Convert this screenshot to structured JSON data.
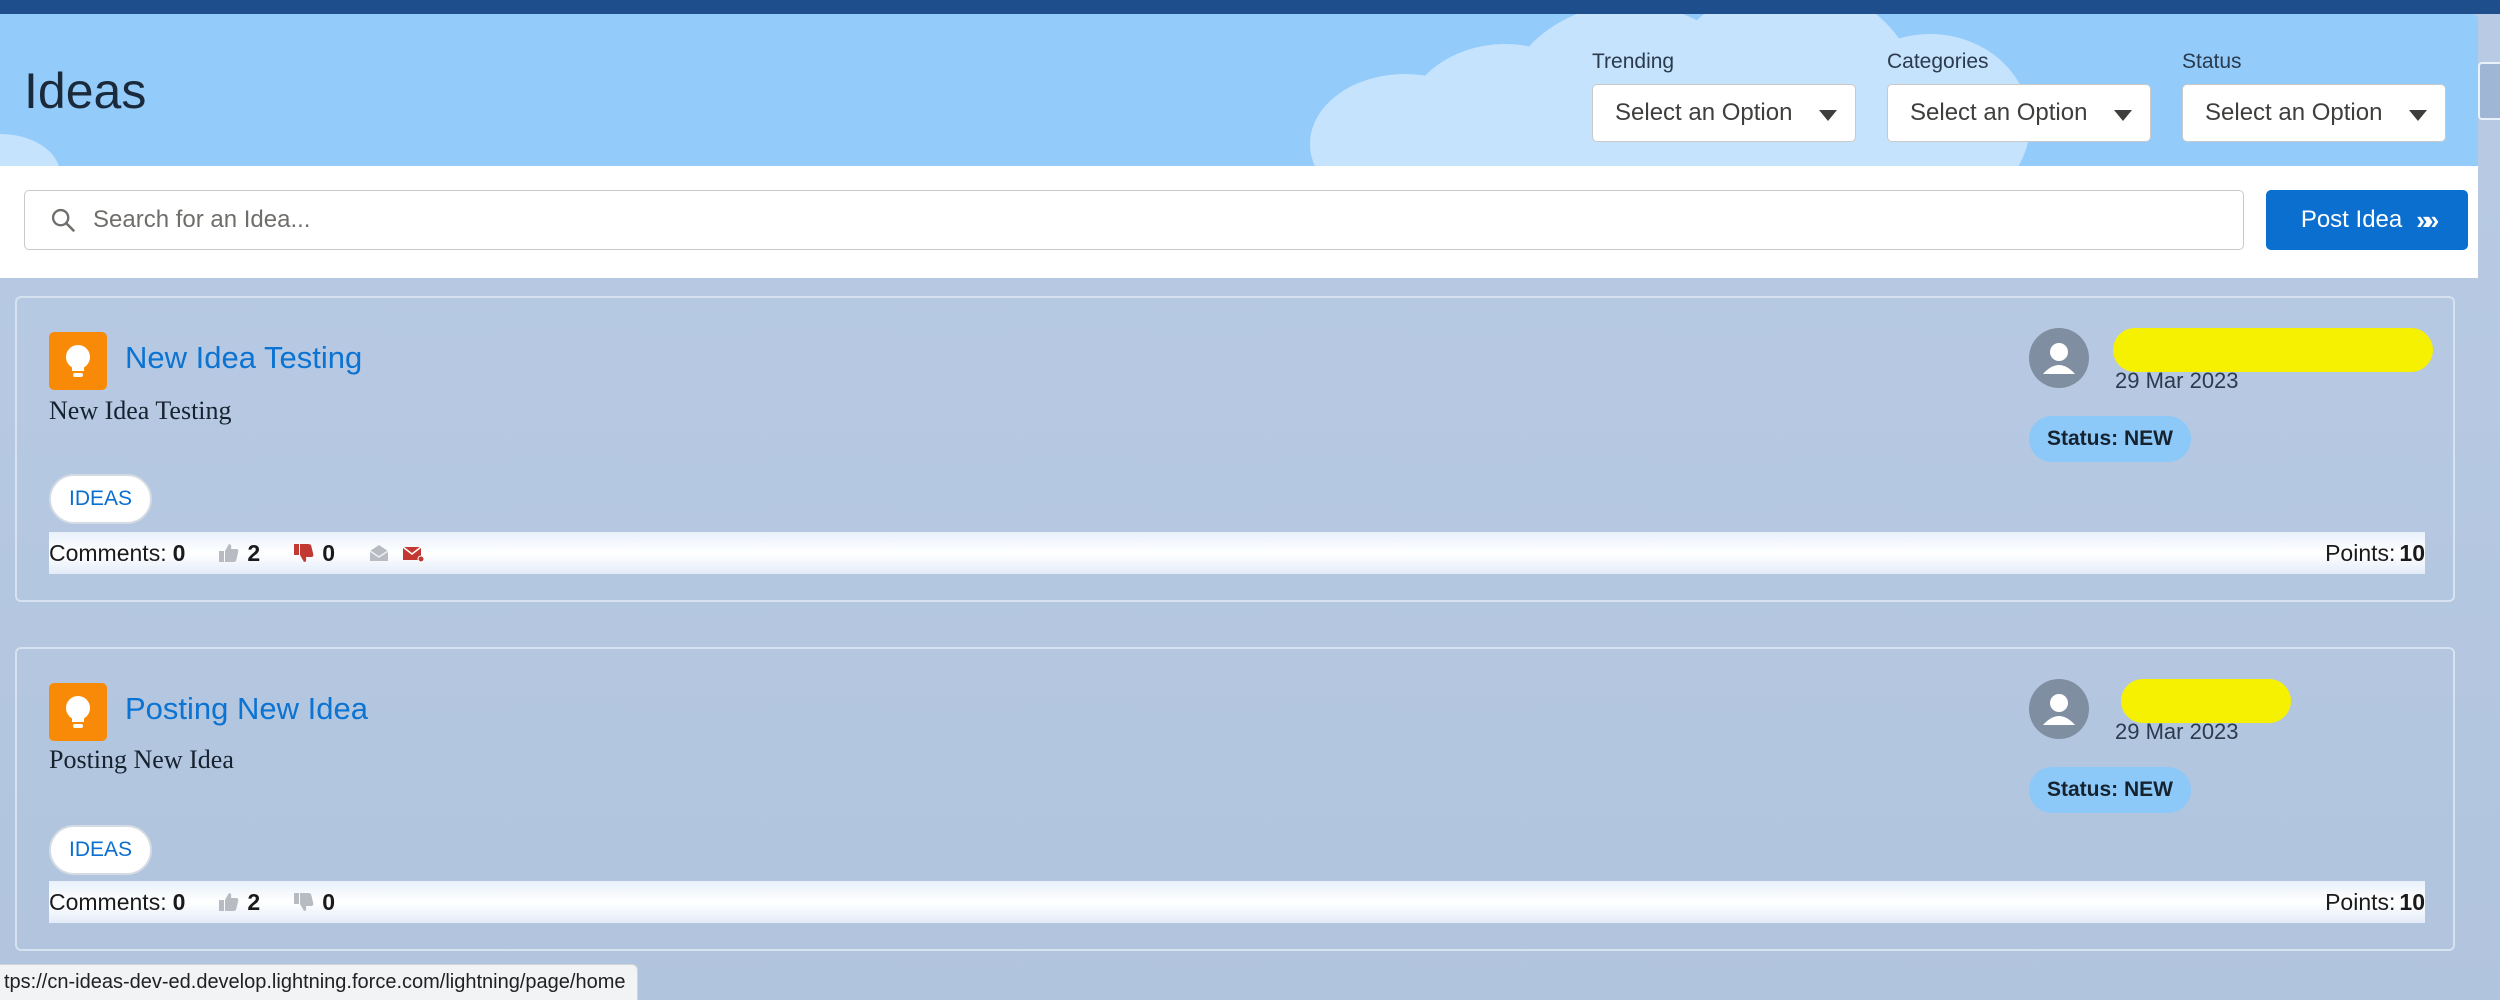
{
  "header": {
    "title": "Ideas",
    "filters": [
      {
        "label": "Trending",
        "value": "Select an Option"
      },
      {
        "label": "Categories",
        "value": "Select an Option"
      },
      {
        "label": "Status",
        "value": "Select an Option"
      }
    ]
  },
  "search": {
    "placeholder": "Search for an Idea...",
    "post_label": "Post Idea"
  },
  "ideas": [
    {
      "title": "New Idea Testing",
      "body": "New Idea Testing",
      "tag": "IDEAS",
      "date": "29 Mar 2023",
      "status": "Status: NEW",
      "comments_label": "Comments:",
      "comments": "0",
      "upvotes": "2",
      "downvotes": "0",
      "points_label": "Points:",
      "points": "10"
    },
    {
      "title": "Posting New Idea",
      "body": "Posting New Idea",
      "tag": "IDEAS",
      "date": "29 Mar 2023",
      "status": "Status: NEW",
      "comments_label": "Comments:",
      "comments": "0",
      "upvotes": "2",
      "downvotes": "0",
      "points_label": "Points:",
      "points": "10"
    }
  ],
  "statusbar": {
    "url": "tps://cn-ideas-dev-ed.develop.lightning.force.com/lightning/page/home"
  },
  "colors": {
    "accent": "#0b6fd0",
    "idea_icon": "#f88a08",
    "downvote_active": "#c23934",
    "redaction": "#f6f100"
  }
}
